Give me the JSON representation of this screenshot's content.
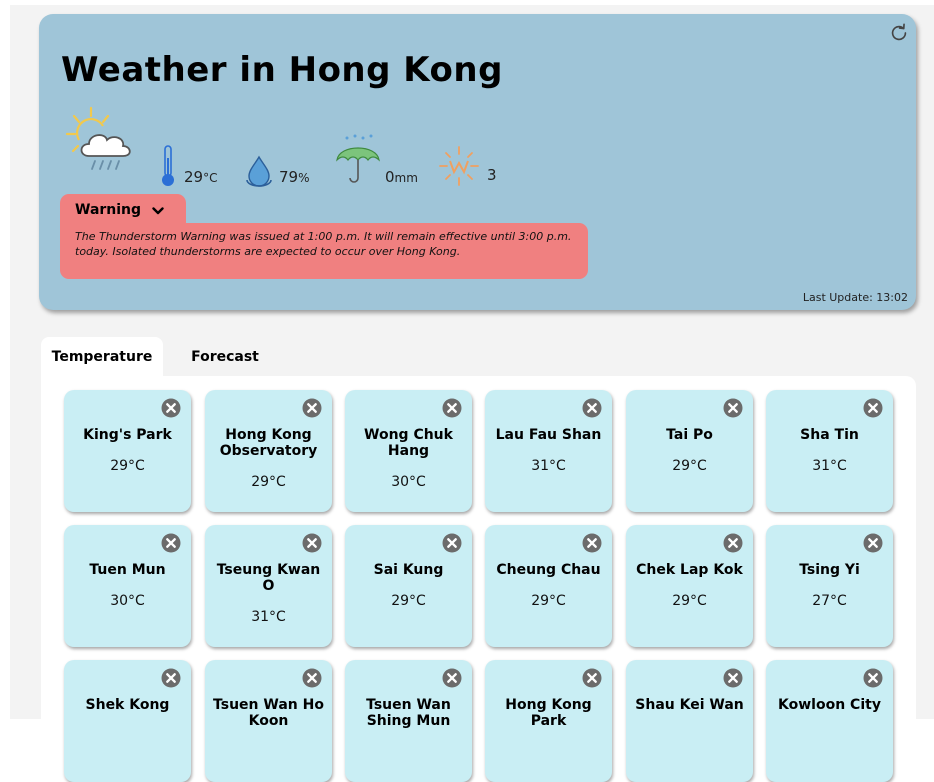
{
  "header": {
    "title": "Weather in Hong Kong",
    "last_update": "Last Update: 13:02"
  },
  "current": {
    "weather_icon": "sun-cloud-rain-icon",
    "temperature_value": "29",
    "temperature_unit": "°C",
    "humidity_value": "79",
    "humidity_unit": "%",
    "rainfall_value": "0",
    "rainfall_unit": "mm",
    "uv_value": "3"
  },
  "warning": {
    "label": "Warning",
    "text": "The Thunderstorm Warning was issued at 1:00 p.m. It will remain effective until 3:00 p.m. today. Isolated thunderstorms are expected to occur over Hong Kong."
  },
  "tabs": [
    {
      "label": "Temperature",
      "active": true
    },
    {
      "label": "Forecast",
      "active": false
    }
  ],
  "stations": [
    {
      "name": "King's Park",
      "temp": "29°C"
    },
    {
      "name": "Hong Kong Observatory",
      "temp": "29°C"
    },
    {
      "name": "Wong Chuk Hang",
      "temp": "30°C"
    },
    {
      "name": "Lau Fau Shan",
      "temp": "31°C"
    },
    {
      "name": "Tai Po",
      "temp": "29°C"
    },
    {
      "name": "Sha Tin",
      "temp": "31°C"
    },
    {
      "name": "Tuen Mun",
      "temp": "30°C"
    },
    {
      "name": "Tseung Kwan O",
      "temp": "31°C"
    },
    {
      "name": "Sai Kung",
      "temp": "29°C"
    },
    {
      "name": "Cheung Chau",
      "temp": "29°C"
    },
    {
      "name": "Chek Lap Kok",
      "temp": "29°C"
    },
    {
      "name": "Tsing Yi",
      "temp": "27°C"
    },
    {
      "name": "Shek Kong",
      "temp": ""
    },
    {
      "name": "Tsuen Wan Ho Koon",
      "temp": ""
    },
    {
      "name": "Tsuen Wan Shing Mun",
      "temp": ""
    },
    {
      "name": "Hong Kong Park",
      "temp": ""
    },
    {
      "name": "Shau Kei Wan",
      "temp": ""
    },
    {
      "name": "Kowloon City",
      "temp": ""
    }
  ],
  "colors": {
    "hero_bg": "#9fc5d8",
    "warning_bg": "#f08080",
    "card_bg": "#c9eef4"
  }
}
